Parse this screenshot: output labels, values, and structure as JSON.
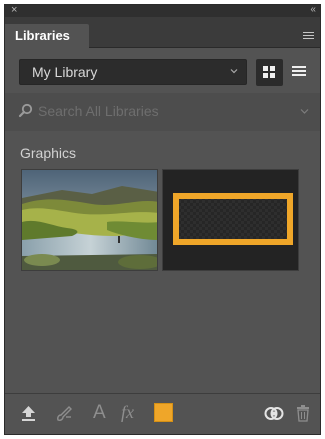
{
  "window": {
    "close_glyph": "×",
    "collapse_glyph": "‹‹"
  },
  "panel": {
    "tab_label": "Libraries",
    "menu_icon": "panel-menu-icon"
  },
  "library": {
    "selected": "My Library",
    "view_mode": "grid"
  },
  "search": {
    "placeholder": "Search All Libraries"
  },
  "content": {
    "section_title": "Graphics",
    "items": [
      {
        "type": "photo",
        "description_icon": "landscape-river-thumbnail"
      },
      {
        "type": "graphic",
        "description_icon": "orange-rectangle-thumbnail"
      }
    ]
  },
  "toolbar": {
    "icons": [
      "upload-icon",
      "brush-icon",
      "character-style-icon",
      "layer-style-icon",
      "color-swatch",
      "creative-cloud-icon",
      "trash-icon"
    ],
    "text_glyph": "A",
    "fx_glyph": "fx",
    "swatch_color": "#efa629"
  },
  "colors": {
    "panel_bg": "#535353",
    "accent_orange": "#efa629"
  }
}
